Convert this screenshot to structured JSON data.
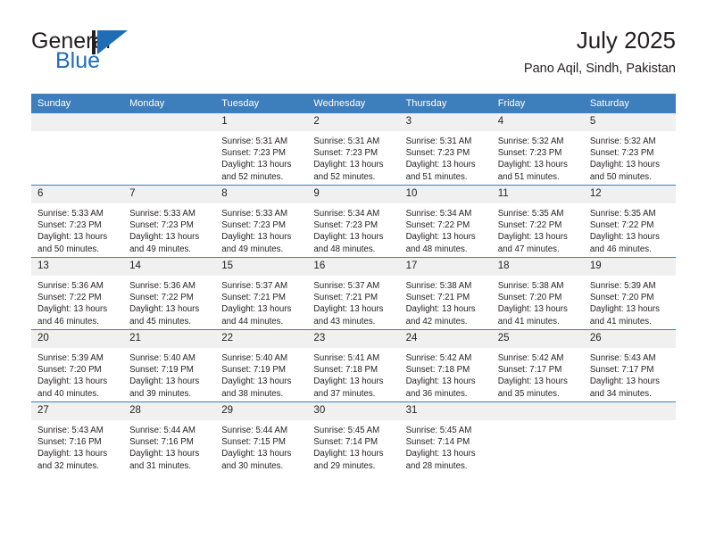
{
  "brand": {
    "name_primary": "General",
    "name_secondary": "Blue",
    "accent_color": "#1f6db5"
  },
  "header": {
    "title": "July 2025",
    "subtitle": "Pano Aqil, Sindh, Pakistan"
  },
  "calendar": {
    "header_bg": "#3d7ebc",
    "daynum_bg": "#f0f0f0",
    "weekday_headers": [
      "Sunday",
      "Monday",
      "Tuesday",
      "Wednesday",
      "Thursday",
      "Friday",
      "Saturday"
    ],
    "weeks": [
      [
        {
          "day": "",
          "lines": []
        },
        {
          "day": "",
          "lines": []
        },
        {
          "day": "1",
          "lines": [
            "Sunrise: 5:31 AM",
            "Sunset: 7:23 PM",
            "Daylight: 13 hours",
            "and 52 minutes."
          ]
        },
        {
          "day": "2",
          "lines": [
            "Sunrise: 5:31 AM",
            "Sunset: 7:23 PM",
            "Daylight: 13 hours",
            "and 52 minutes."
          ]
        },
        {
          "day": "3",
          "lines": [
            "Sunrise: 5:31 AM",
            "Sunset: 7:23 PM",
            "Daylight: 13 hours",
            "and 51 minutes."
          ]
        },
        {
          "day": "4",
          "lines": [
            "Sunrise: 5:32 AM",
            "Sunset: 7:23 PM",
            "Daylight: 13 hours",
            "and 51 minutes."
          ]
        },
        {
          "day": "5",
          "lines": [
            "Sunrise: 5:32 AM",
            "Sunset: 7:23 PM",
            "Daylight: 13 hours",
            "and 50 minutes."
          ]
        }
      ],
      [
        {
          "day": "6",
          "lines": [
            "Sunrise: 5:33 AM",
            "Sunset: 7:23 PM",
            "Daylight: 13 hours",
            "and 50 minutes."
          ]
        },
        {
          "day": "7",
          "lines": [
            "Sunrise: 5:33 AM",
            "Sunset: 7:23 PM",
            "Daylight: 13 hours",
            "and 49 minutes."
          ]
        },
        {
          "day": "8",
          "lines": [
            "Sunrise: 5:33 AM",
            "Sunset: 7:23 PM",
            "Daylight: 13 hours",
            "and 49 minutes."
          ]
        },
        {
          "day": "9",
          "lines": [
            "Sunrise: 5:34 AM",
            "Sunset: 7:23 PM",
            "Daylight: 13 hours",
            "and 48 minutes."
          ]
        },
        {
          "day": "10",
          "lines": [
            "Sunrise: 5:34 AM",
            "Sunset: 7:22 PM",
            "Daylight: 13 hours",
            "and 48 minutes."
          ]
        },
        {
          "day": "11",
          "lines": [
            "Sunrise: 5:35 AM",
            "Sunset: 7:22 PM",
            "Daylight: 13 hours",
            "and 47 minutes."
          ]
        },
        {
          "day": "12",
          "lines": [
            "Sunrise: 5:35 AM",
            "Sunset: 7:22 PM",
            "Daylight: 13 hours",
            "and 46 minutes."
          ]
        }
      ],
      [
        {
          "day": "13",
          "lines": [
            "Sunrise: 5:36 AM",
            "Sunset: 7:22 PM",
            "Daylight: 13 hours",
            "and 46 minutes."
          ]
        },
        {
          "day": "14",
          "lines": [
            "Sunrise: 5:36 AM",
            "Sunset: 7:22 PM",
            "Daylight: 13 hours",
            "and 45 minutes."
          ]
        },
        {
          "day": "15",
          "lines": [
            "Sunrise: 5:37 AM",
            "Sunset: 7:21 PM",
            "Daylight: 13 hours",
            "and 44 minutes."
          ]
        },
        {
          "day": "16",
          "lines": [
            "Sunrise: 5:37 AM",
            "Sunset: 7:21 PM",
            "Daylight: 13 hours",
            "and 43 minutes."
          ]
        },
        {
          "day": "17",
          "lines": [
            "Sunrise: 5:38 AM",
            "Sunset: 7:21 PM",
            "Daylight: 13 hours",
            "and 42 minutes."
          ]
        },
        {
          "day": "18",
          "lines": [
            "Sunrise: 5:38 AM",
            "Sunset: 7:20 PM",
            "Daylight: 13 hours",
            "and 41 minutes."
          ]
        },
        {
          "day": "19",
          "lines": [
            "Sunrise: 5:39 AM",
            "Sunset: 7:20 PM",
            "Daylight: 13 hours",
            "and 41 minutes."
          ]
        }
      ],
      [
        {
          "day": "20",
          "lines": [
            "Sunrise: 5:39 AM",
            "Sunset: 7:20 PM",
            "Daylight: 13 hours",
            "and 40 minutes."
          ]
        },
        {
          "day": "21",
          "lines": [
            "Sunrise: 5:40 AM",
            "Sunset: 7:19 PM",
            "Daylight: 13 hours",
            "and 39 minutes."
          ]
        },
        {
          "day": "22",
          "lines": [
            "Sunrise: 5:40 AM",
            "Sunset: 7:19 PM",
            "Daylight: 13 hours",
            "and 38 minutes."
          ]
        },
        {
          "day": "23",
          "lines": [
            "Sunrise: 5:41 AM",
            "Sunset: 7:18 PM",
            "Daylight: 13 hours",
            "and 37 minutes."
          ]
        },
        {
          "day": "24",
          "lines": [
            "Sunrise: 5:42 AM",
            "Sunset: 7:18 PM",
            "Daylight: 13 hours",
            "and 36 minutes."
          ]
        },
        {
          "day": "25",
          "lines": [
            "Sunrise: 5:42 AM",
            "Sunset: 7:17 PM",
            "Daylight: 13 hours",
            "and 35 minutes."
          ]
        },
        {
          "day": "26",
          "lines": [
            "Sunrise: 5:43 AM",
            "Sunset: 7:17 PM",
            "Daylight: 13 hours",
            "and 34 minutes."
          ]
        }
      ],
      [
        {
          "day": "27",
          "lines": [
            "Sunrise: 5:43 AM",
            "Sunset: 7:16 PM",
            "Daylight: 13 hours",
            "and 32 minutes."
          ]
        },
        {
          "day": "28",
          "lines": [
            "Sunrise: 5:44 AM",
            "Sunset: 7:16 PM",
            "Daylight: 13 hours",
            "and 31 minutes."
          ]
        },
        {
          "day": "29",
          "lines": [
            "Sunrise: 5:44 AM",
            "Sunset: 7:15 PM",
            "Daylight: 13 hours",
            "and 30 minutes."
          ]
        },
        {
          "day": "30",
          "lines": [
            "Sunrise: 5:45 AM",
            "Sunset: 7:14 PM",
            "Daylight: 13 hours",
            "and 29 minutes."
          ]
        },
        {
          "day": "31",
          "lines": [
            "Sunrise: 5:45 AM",
            "Sunset: 7:14 PM",
            "Daylight: 13 hours",
            "and 28 minutes."
          ]
        },
        {
          "day": "",
          "lines": []
        },
        {
          "day": "",
          "lines": []
        }
      ]
    ]
  }
}
